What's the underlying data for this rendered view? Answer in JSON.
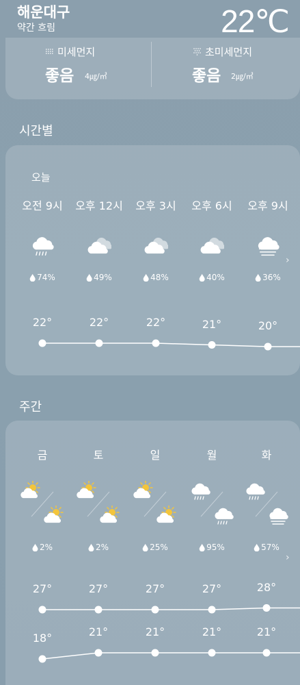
{
  "header": {
    "location": "해운대구",
    "condition": "약간 흐림",
    "temperature": "22℃"
  },
  "dust": {
    "pm10": {
      "label": "미세먼지",
      "status": "좋음",
      "value": "4㎍/㎥"
    },
    "pm25": {
      "label": "초미세먼지",
      "status": "좋음",
      "value": "2㎍/㎥"
    }
  },
  "hourly": {
    "title": "시간별",
    "day_label": "오늘",
    "items": [
      {
        "time": "오전 9시",
        "icon": "cloud-rain-icon",
        "pop": "74%",
        "temp": "22°",
        "t": 22
      },
      {
        "time": "오후 12시",
        "icon": "cloudy-icon",
        "pop": "49%",
        "temp": "22°",
        "t": 22
      },
      {
        "time": "오후 3시",
        "icon": "cloudy-icon",
        "pop": "48%",
        "temp": "22°",
        "t": 22
      },
      {
        "time": "오후 6시",
        "icon": "cloudy-icon",
        "pop": "40%",
        "temp": "21°",
        "t": 21
      },
      {
        "time": "오후 9시",
        "icon": "cloud-fog-icon",
        "pop": "36%",
        "temp": "20°",
        "t": 20
      }
    ],
    "more": "›"
  },
  "weekly": {
    "title": "주간",
    "items": [
      {
        "day": "금",
        "am_icon": "partly-cloudy-icon",
        "pm_icon": "partly-cloudy-icon",
        "pop": "2%",
        "high": "27°",
        "low": "18°",
        "h": 27,
        "l": 18
      },
      {
        "day": "토",
        "am_icon": "partly-cloudy-icon",
        "pm_icon": "partly-cloudy-icon",
        "pop": "2%",
        "high": "27°",
        "low": "21°",
        "h": 27,
        "l": 21
      },
      {
        "day": "일",
        "am_icon": "partly-cloudy-icon",
        "pm_icon": "partly-cloudy-icon",
        "pop": "25%",
        "high": "27°",
        "low": "21°",
        "h": 27,
        "l": 21
      },
      {
        "day": "월",
        "am_icon": "cloud-rain-icon",
        "pm_icon": "cloud-rain-icon",
        "pop": "95%",
        "high": "27°",
        "low": "21°",
        "h": 27,
        "l": 21
      },
      {
        "day": "화",
        "am_icon": "cloud-rain-icon",
        "pm_icon": "cloud-fog-icon",
        "pop": "57%",
        "high": "28°",
        "low": "21°",
        "h": 28,
        "l": 21
      }
    ],
    "more": "›"
  }
}
